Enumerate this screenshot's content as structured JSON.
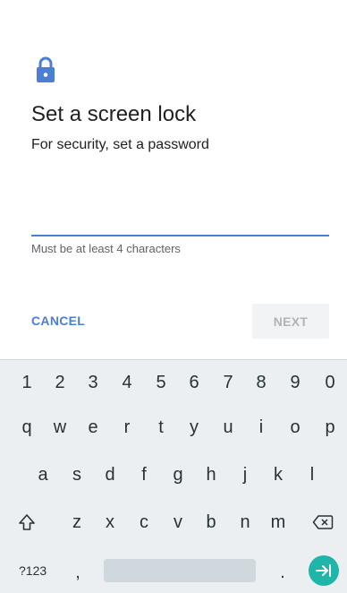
{
  "app": {
    "title": "Set a screen lock",
    "subtitle": "For security, set a password",
    "lock_icon": "lock-icon",
    "accent_color": "#4a7fd4"
  },
  "password": {
    "value": "",
    "hint": "Must be at least 4 characters"
  },
  "actions": {
    "cancel_label": "CANCEL",
    "next_label": "NEXT"
  },
  "keyboard": {
    "number_row": [
      "1",
      "2",
      "3",
      "4",
      "5",
      "6",
      "7",
      "8",
      "9",
      "0"
    ],
    "row1": [
      "q",
      "w",
      "e",
      "r",
      "t",
      "y",
      "u",
      "i",
      "o",
      "p"
    ],
    "row2": [
      "a",
      "s",
      "d",
      "f",
      "g",
      "h",
      "j",
      "k",
      "l"
    ],
    "row3": [
      "z",
      "x",
      "c",
      "v",
      "b",
      "n",
      "m"
    ],
    "symbols_label": "?123",
    "comma": ",",
    "period": ".",
    "shift_icon": "shift-icon",
    "backspace_icon": "backspace-icon",
    "enter_icon": "enter-next-icon",
    "enter_color": "#1fb5a8"
  }
}
